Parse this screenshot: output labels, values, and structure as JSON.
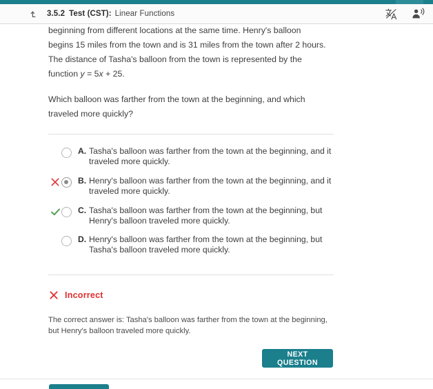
{
  "header": {
    "back_icon": "arrow-up-level-icon",
    "code": "3.5.2",
    "test_label": "Test (CST):",
    "subject": "Linear Functions",
    "translate_icon": "translate-icon",
    "read_aloud_icon": "read-aloud-icon"
  },
  "question": {
    "paragraph1_pre": "beginning from different locations at the same time. Henry's balloon begins 15 miles from the town and is 31 miles from the town after 2 hours. The distance of Tasha's balloon from the town is represented by the function ",
    "var_y": "y",
    "eq_mid": " = 5",
    "var_x": "x",
    "eq_end": " + 25.",
    "paragraph2": "Which balloon was farther from the town at the beginning, and which traveled more quickly?"
  },
  "options": [
    {
      "letter": "A.",
      "text": "Tasha's balloon was farther from the town at the beginning, and it traveled more quickly.",
      "selected": false,
      "mark": "none"
    },
    {
      "letter": "B.",
      "text": "Henry's balloon was farther from the town at the beginning, and it traveled more quickly.",
      "selected": true,
      "mark": "incorrect-x"
    },
    {
      "letter": "C.",
      "text": "Tasha's balloon was farther from the town at the beginning, but Henry's balloon traveled more quickly.",
      "selected": false,
      "mark": "correct-check"
    },
    {
      "letter": "D.",
      "text": "Henry's balloon was farther from the town at the beginning, but Tasha's balloon traveled more quickly.",
      "selected": false,
      "mark": "none"
    }
  ],
  "feedback": {
    "icon": "x-icon",
    "status": "Incorrect",
    "explanation": "The correct answer is: Tasha's balloon was farther from the town at the beginning, but Henry's balloon traveled more quickly."
  },
  "next_button": {
    "label": "NEXT QUESTION"
  },
  "colors": {
    "accent_teal": "#1b7f8c",
    "incorrect_red": "#e03030",
    "correct_green": "#4a9a4a",
    "text": "#3d3d3d"
  }
}
